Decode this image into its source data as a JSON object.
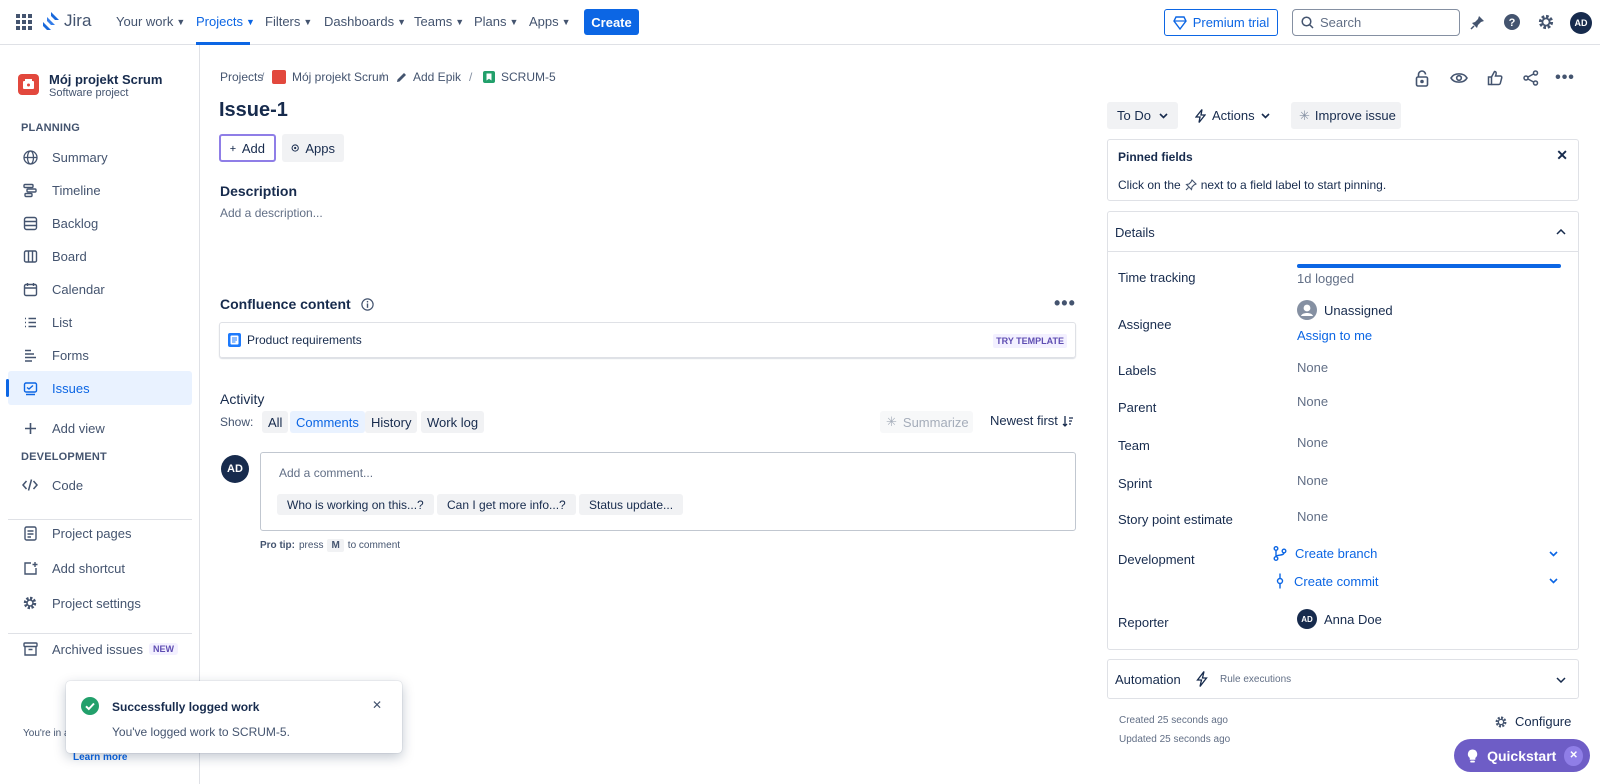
{
  "topnav": {
    "logo": "Jira",
    "items": [
      {
        "label": "Your work"
      },
      {
        "label": "Projects"
      },
      {
        "label": "Filters"
      },
      {
        "label": "Dashboards"
      },
      {
        "label": "Teams"
      },
      {
        "label": "Plans"
      },
      {
        "label": "Apps"
      }
    ],
    "create_label": "Create",
    "premium_label": "Premium trial",
    "search_placeholder": "Search",
    "avatar_initials": "AD"
  },
  "sidebar": {
    "project_name": "Mój projekt Scrum",
    "project_type": "Software project",
    "planning_heading": "PLANNING",
    "items": [
      {
        "label": "Summary",
        "icon": "globe-icon"
      },
      {
        "label": "Timeline",
        "icon": "timeline-icon"
      },
      {
        "label": "Backlog",
        "icon": "backlog-icon"
      },
      {
        "label": "Board",
        "icon": "board-icon"
      },
      {
        "label": "Calendar",
        "icon": "calendar-icon"
      },
      {
        "label": "List",
        "icon": "list-icon"
      },
      {
        "label": "Forms",
        "icon": "forms-icon"
      },
      {
        "label": "Issues",
        "icon": "issues-icon"
      }
    ],
    "add_view_label": "Add view",
    "development_heading": "DEVELOPMENT",
    "code_label": "Code",
    "project_pages_label": "Project pages",
    "add_shortcut_label": "Add shortcut",
    "project_settings_label": "Project settings",
    "archived_label": "Archived issues",
    "archived_badge": "NEW",
    "footer_text": "You're in a",
    "learn_more": "Learn more"
  },
  "breadcrumb": {
    "projects": "Projects",
    "project": "Mój projekt Scrum",
    "epic": "Add Epik",
    "issue_key": "SCRUM-5"
  },
  "issue": {
    "title": "Issue-1",
    "add_label": "Add",
    "apps_label": "Apps",
    "description_heading": "Description",
    "description_placeholder": "Add a description...",
    "confluence_heading": "Confluence content",
    "confluence_item": "Product requirements",
    "try_template": "TRY TEMPLATE"
  },
  "activity": {
    "heading": "Activity",
    "show_label": "Show:",
    "filters": [
      "All",
      "Comments",
      "History",
      "Work log"
    ],
    "selected_filter": "Comments",
    "summarize_label": "Summarize",
    "sort_label": "Newest first",
    "avatar_initials": "AD",
    "comment_placeholder": "Add a comment...",
    "suggestions": [
      "Who is working on this...?",
      "Can I get more info...?",
      "Status update..."
    ],
    "pro_tip_prefix": "Pro tip:",
    "pro_tip_press": "press",
    "pro_tip_key": "M",
    "pro_tip_suffix": "to comment"
  },
  "right_panel": {
    "status": "To Do",
    "actions_label": "Actions",
    "improve_label": "Improve issue",
    "pinned_title": "Pinned fields",
    "pinned_text_before": "Click on the",
    "pinned_text_after": "next to a field label to start pinning.",
    "details_title": "Details",
    "time_tracking_label": "Time tracking",
    "time_tracking_value": "1d logged",
    "time_tracking_progress": 1.0,
    "assignee_label": "Assignee",
    "assignee_value": "Unassigned",
    "assign_to_me": "Assign to me",
    "labels_label": "Labels",
    "labels_value": "None",
    "parent_label": "Parent",
    "parent_value": "None",
    "team_label": "Team",
    "team_value": "None",
    "sprint_label": "Sprint",
    "sprint_value": "None",
    "story_points_label": "Story point estimate",
    "story_points_value": "None",
    "development_label": "Development",
    "create_branch": "Create branch",
    "create_commit": "Create commit",
    "reporter_label": "Reporter",
    "reporter_initials": "AD",
    "reporter_name": "Anna Doe",
    "automation_label": "Automation",
    "rule_executions": "Rule executions",
    "created": "Created 25 seconds ago",
    "updated": "Updated 25 seconds ago",
    "configure_label": "Configure"
  },
  "toast": {
    "title": "Successfully logged work",
    "message": "You've logged work to SCRUM-5."
  },
  "quickstart_label": "Quickstart",
  "colors": {
    "brand_blue": "#0c66e4",
    "success_green": "#22a06b",
    "quickstart_purple": "#6e5dc6"
  }
}
